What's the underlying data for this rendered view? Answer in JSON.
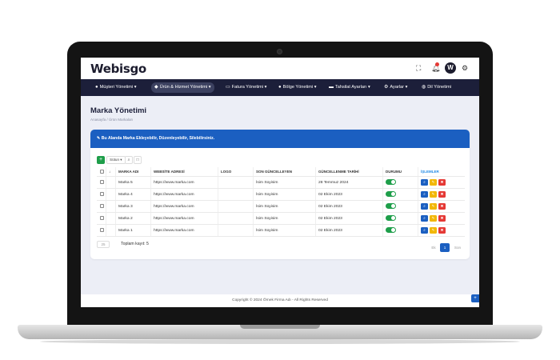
{
  "app": {
    "brand": "Webisgo",
    "avatar_letter": "W"
  },
  "nav": [
    {
      "label": "Müşteri Yönetimi",
      "icon": "users-icon",
      "glyph": "👥"
    },
    {
      "label": "Ürün & Hizmet Yönetimi",
      "icon": "boxes-icon",
      "glyph": "⚙"
    },
    {
      "label": "Fatura Yönetimi",
      "icon": "invoice-icon",
      "glyph": "▭"
    },
    {
      "label": "Bölge Yönetimi",
      "icon": "map-pin-icon",
      "glyph": "⌖"
    },
    {
      "label": "Tahsilat Ayarları",
      "icon": "card-icon",
      "glyph": "▬"
    },
    {
      "label": "Ayarlar",
      "icon": "gears-icon",
      "glyph": "⚙"
    },
    {
      "label": "Dil Yönetimi",
      "icon": "globe-icon",
      "glyph": "◍"
    }
  ],
  "page": {
    "title": "Marka Yönetimi",
    "breadcrumb": "Anasayfa / Ürün Markaları",
    "info": "Bu Alanda Marka Ekleyebilir, Düzenleyebilir, Silebilirsiniz."
  },
  "toolbar": {
    "add": "+",
    "columns_label": "Sütun",
    "search": "Q",
    "fullscreen": "□"
  },
  "table": {
    "headers": {
      "name": "MARKA ADI",
      "website": "WEBSİTE ADRESİ",
      "logo": "LOGO",
      "updated_by": "SON GÜNCELLEYEN",
      "updated_at": "GÜNCELLENME TARİHİ",
      "status": "DURUMU",
      "actions": "İŞLEMLER"
    },
    "rows": [
      {
        "name": "Marka 5",
        "website": "https://www.marka.com",
        "logo": "",
        "updated_by": "İsim Soyisim",
        "updated_at": "28 Temmuz 2024",
        "status": true
      },
      {
        "name": "Marka 4",
        "website": "https://www.marka.com",
        "logo": "",
        "updated_by": "İsim Soyisim",
        "updated_at": "02 Ekim 2023",
        "status": true
      },
      {
        "name": "Marka 3",
        "website": "https://www.marka.com",
        "logo": "",
        "updated_by": "İsim Soyisim",
        "updated_at": "02 Ekim 2023",
        "status": true
      },
      {
        "name": "Marka 2",
        "website": "https://www.marka.com",
        "logo": "",
        "updated_by": "İsim Soyisim",
        "updated_at": "02 Ekim 2023",
        "status": true
      },
      {
        "name": "Marka 1",
        "website": "https://www.marka.com",
        "logo": "",
        "updated_by": "İsim Soyisim",
        "updated_at": "02 Ekim 2023",
        "status": true
      }
    ]
  },
  "pagination": {
    "page_size": "25",
    "total": "Toplam kayıt: 5",
    "prev": "Ek",
    "current": "1",
    "next": "Son"
  },
  "footer": {
    "copyright": "Copyright © 2024 Örnek Firma Adı - All Rights Reserved"
  },
  "colors": {
    "primary": "#1b5fc1",
    "navbar": "#1c1f3a",
    "success": "#1e9e4a",
    "warning": "#f2b705",
    "danger": "#e53935"
  }
}
